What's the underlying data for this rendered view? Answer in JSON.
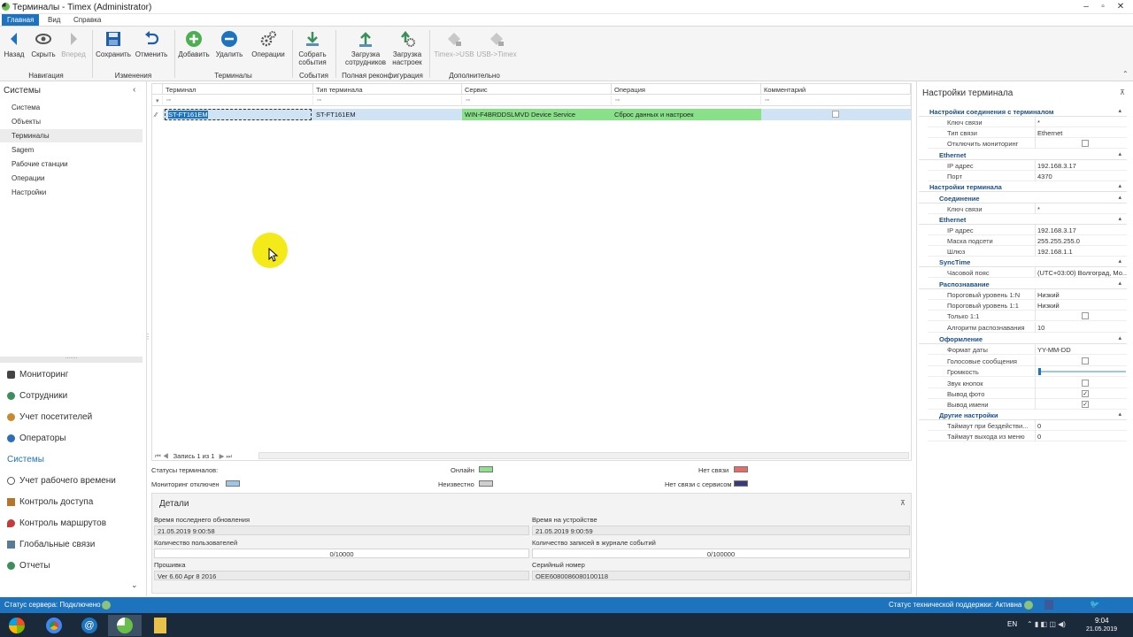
{
  "window": {
    "title": "Терминалы - Timex (Administrator)"
  },
  "menu": {
    "tabs": [
      "Главная",
      "Вид",
      "Справка"
    ]
  },
  "ribbon": {
    "buttons": {
      "back": "Назад",
      "hide": "Скрыть",
      "forward": "Вперед",
      "save": "Сохранить",
      "cancel": "Отменить",
      "add": "Добавить",
      "delete": "Удалить",
      "operations": "Операции",
      "collect_line1": "Собрать",
      "collect_line2": "события",
      "load_staff_line1": "Загрузка",
      "load_staff_line2": "сотрудников",
      "load_settings_line1": "Загрузка",
      "load_settings_line2": "настроек",
      "timex_usb": "Timex->USB",
      "usb_timex": "USB->Timex"
    },
    "groups": {
      "navigation": "Навигация",
      "changes": "Изменения",
      "terminals": "Терминалы",
      "events": "События",
      "full_reconfig": "Полная реконфигурация",
      "additional": "Дополнительно"
    }
  },
  "left": {
    "header": "Системы",
    "systems": [
      "Система",
      "Объекты",
      "Терминалы",
      "Sagem",
      "Рабочие станции",
      "Операции",
      "Настройки"
    ],
    "nav": [
      "Мониторинг",
      "Сотрудники",
      "Учет посетителей",
      "Операторы",
      "Системы",
      "Учет рабочего времени",
      "Контроль доступа",
      "Контроль маршрутов",
      "Глобальные связи",
      "Отчеты"
    ]
  },
  "grid": {
    "columns": [
      "Терминал",
      "Тип терминала",
      "Сервис",
      "Операция",
      "Комментарий"
    ],
    "rows": [
      {
        "terminal": "ST-FT161EM",
        "type": "ST-FT161EM",
        "service": "WIN-F4BRDDSLMVD Device Service",
        "operation": "Сброс данных и настроек",
        "comment": ""
      }
    ],
    "pager": "Запись 1 из 1"
  },
  "legend": {
    "title": "Статусы терминалов:",
    "online": "Онлайн",
    "no_link": "Нет связи",
    "monitoring_off": "Мониторинг отключен",
    "unknown": "Неизвестно",
    "no_service_link": "Нет связи с сервисом",
    "colors": {
      "online": "#8fe08f",
      "no_link": "#e86a6a",
      "monitoring_off": "#9cc7e8",
      "unknown": "#cfcfcf",
      "no_service_link": "#3a3a7a"
    }
  },
  "details": {
    "title": "Детали",
    "last_update_label": "Время последнего обновления",
    "last_update": "21.05.2019 9:00:58",
    "device_time_label": "Время на устройстве",
    "device_time": "21.05.2019 9:00:59",
    "users_label": "Количество пользователей",
    "users": "0/10000",
    "log_label": "Количество записей в журнале событий",
    "log": "0/100000",
    "firmware_label": "Прошивка",
    "firmware": "Ver 6.60 Apr  8 2016",
    "serial_label": "Серийный номер",
    "serial": "OEE6080086080100118"
  },
  "props": {
    "title": "Настройки терминала",
    "conn_section": "Настройки соединения с терминалом",
    "conn_key_k": "Ключ связи",
    "conn_key_v": "*",
    "conn_type_k": "Тип связи",
    "conn_type_v": "Ethernet",
    "mon_off_k": "Отключить мониторинг",
    "eth1": "Ethernet",
    "ip1_k": "IP адрес",
    "ip1_v": "192.168.3.17",
    "port_k": "Порт",
    "port_v": "4370",
    "term_section": "Настройки терминала",
    "connection": "Соединение",
    "key2_k": "Ключ связи",
    "key2_v": "*",
    "eth2": "Ethernet",
    "ip2_k": "IP адрес",
    "ip2_v": "192.168.3.17",
    "mask_k": "Маска подсети",
    "mask_v": "255.255.255.0",
    "gw_k": "Шлюз",
    "gw_v": "192.168.1.1",
    "synctime": "SyncTime",
    "tz_k": "Часовой пояс",
    "tz_v": "(UTC+03:00) Волгоград, Мо...",
    "recog": "Распознавание",
    "thr1n_k": "Пороговый уровень 1:N",
    "thr1n_v": "Низкий",
    "thr11_k": "Пороговый уровень 1:1",
    "thr11_v": "Низкий",
    "only11_k": "Только 1:1",
    "algo_k": "Алгоритм распознавания",
    "algo_v": "10",
    "design": "Оформление",
    "datefmt_k": "Формат даты",
    "datefmt_v": "YY-MM-DD",
    "voice_k": "Голосовые сообщения",
    "volume_k": "Громкость",
    "volume_level": 0,
    "keysound_k": "Звук кнопок",
    "photo_k": "Вывод фото",
    "name_k": "Вывод имени",
    "other": "Другие настройки",
    "idle_k": "Таймаут при бездействи...",
    "idle_v": "0",
    "menu_exit_k": "Таймаут выхода из меню",
    "menu_exit_v": "0"
  },
  "status": {
    "server": "Статус сервера: Подключено",
    "support": "Статус технической поддержки: Активна"
  },
  "taskbar": {
    "lang": "EN",
    "time": "9:04",
    "date": "21.05.2019"
  }
}
